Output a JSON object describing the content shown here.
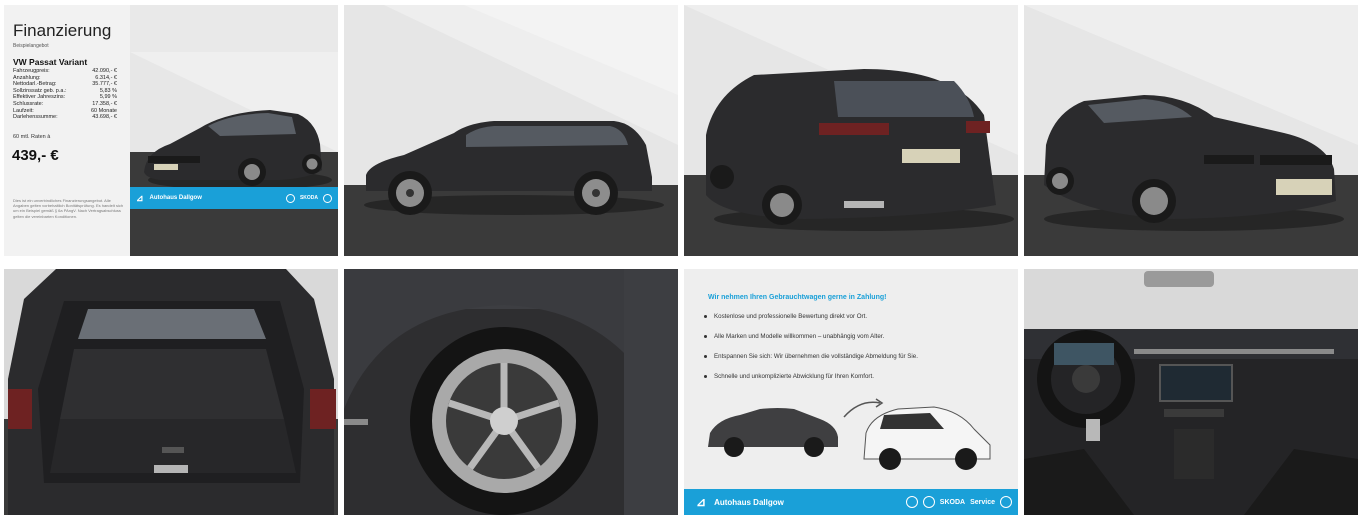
{
  "finance": {
    "title": "Finanzierung",
    "subtitle": "Beispielangebot",
    "model": "VW Passat Variant",
    "rows": [
      {
        "label": "Fahrzeugpreis:",
        "value": "42.090,- €"
      },
      {
        "label": "Anzahlung:",
        "value": "6.314,- €"
      },
      {
        "label": "Nettodarl.-Betrag:",
        "value": "35.777,- €"
      },
      {
        "label": "Sollzinssatz geb. p.a.:",
        "value": "5,83 %"
      },
      {
        "label": "Effektiver Jahreszins:",
        "value": "5,99 %"
      },
      {
        "label": "Schlussrate:",
        "value": "17.358,- €"
      },
      {
        "label": "Laufzeit:",
        "value": "60 Monate"
      },
      {
        "label": "Darlehenssumme:",
        "value": "43.698,- €"
      }
    ],
    "rates_line": "60 mtl. Raten à",
    "monthly_rate": "439,- €",
    "fine_print": "Dies ist ein unverbindliches Finanzierungsangebot. Alle Angaben gelten vorbehaltlich Bonitätsprüfung. Es handelt sich um ein Beispiel gemäß § 6a PAngV. Nach Vertragsabschluss gelten die vereinbarten Konditionen."
  },
  "dealer": {
    "name": "Autohaus Dallgow",
    "brands": [
      "SKODA",
      "Service"
    ]
  },
  "trade_in": {
    "headline": "Wir nehmen Ihren Gebrauchtwagen gerne in Zahlung!",
    "points": [
      "Kostenlose und professionelle Bewertung direkt vor Ort.",
      "Alle Marken und Modelle willkommen – unabhängig vom Alter.",
      "Entspannen Sie sich: Wir übernehmen die vollständige Abmeldung für Sie.",
      "Schnelle und unkomplizierte Abwicklung für Ihren Komfort."
    ]
  },
  "photos": [
    "front-three-quarter",
    "side-profile",
    "rear-three-quarter",
    "front-three-quarter-right",
    "open-trunk",
    "wheel-closeup",
    "trade-in-banner",
    "interior-cockpit"
  ],
  "colors": {
    "accent": "#1aa0d8",
    "car": "#2b2b2d",
    "floor": "#3a3a3a",
    "wall": "#e6e6e6"
  }
}
